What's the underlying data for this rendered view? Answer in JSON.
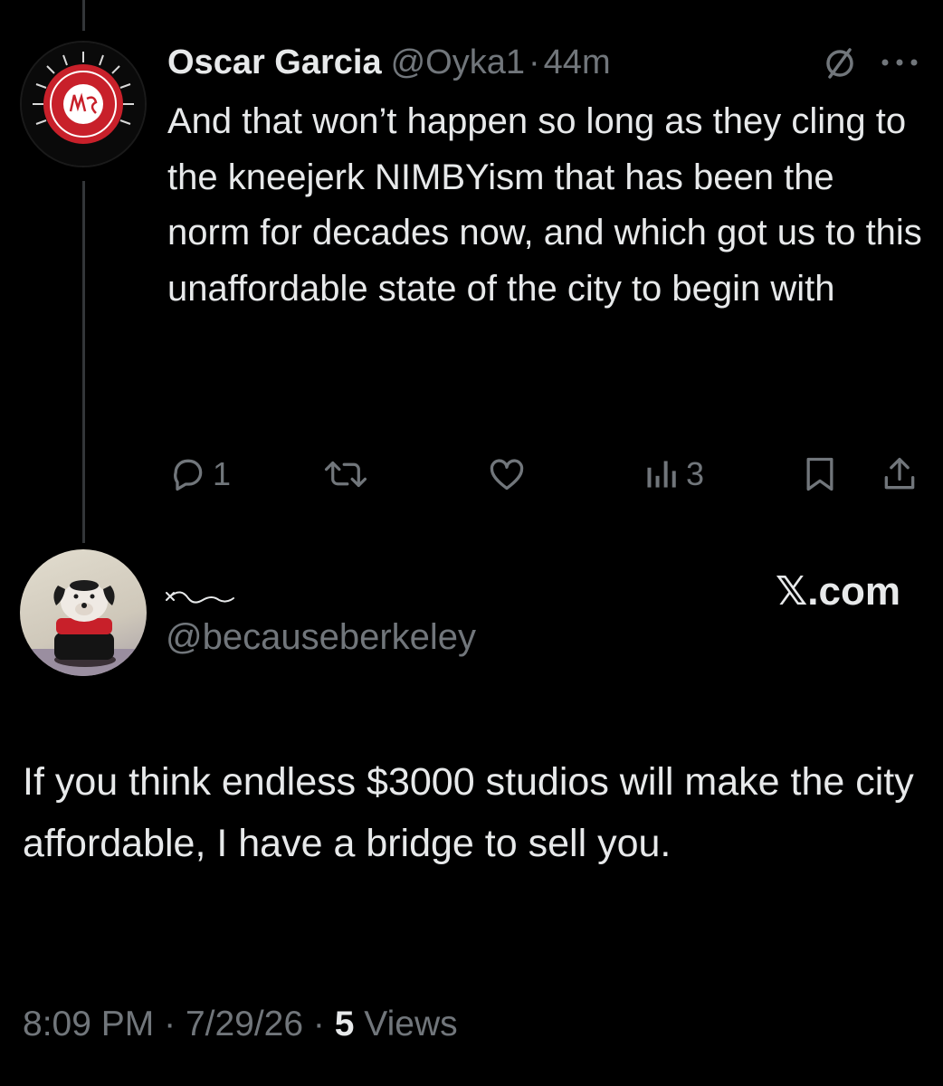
{
  "reply": {
    "display_name": "Oscar Garcia",
    "handle": "@Oyka1",
    "separator": "·",
    "time_ago": "44m",
    "text": "And that won’t happen so long as they cling to the kneejerk NIMBYism that has been the norm for decades now, and which got us to this unaffordable state of the city to begin with",
    "actions": {
      "replies": "1",
      "views": "3"
    }
  },
  "main_post": {
    "handle": "@becauseberkeley",
    "watermark": "𝕏.com",
    "text": "If you think endless $3000 studios will make the city affordable, I have a bridge to sell you.",
    "footer": {
      "time": "8:09 PM",
      "separator": "·",
      "date": "7/29/26",
      "views_count": "5",
      "views_label": "Views"
    }
  },
  "colors": {
    "background": "#000000",
    "text_primary": "#e7e9ea",
    "text_secondary": "#71767b",
    "thread_line": "#333639",
    "badge_red": "#c8202a"
  },
  "icons": [
    "grok-icon",
    "more-icon",
    "reply-icon",
    "retweet-icon",
    "like-icon",
    "views-icon",
    "bookmark-icon",
    "share-icon"
  ]
}
